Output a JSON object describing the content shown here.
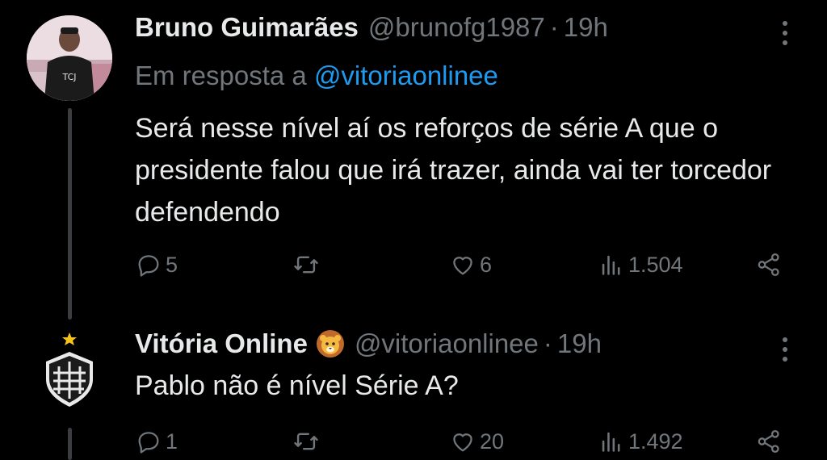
{
  "tweets": [
    {
      "name": "Bruno Guimarães",
      "handle": "@brunofg1987",
      "separator": "·",
      "time": "19h",
      "replying_prefix": "Em resposta a",
      "replying_to": "@vitoriaonlinee",
      "text": "Será nesse nível aí os reforços de série A que o presidente falou que irá trazer, ainda vai ter torcedor defendendo",
      "avatar_shirt_text": "TCJ",
      "replies": "5",
      "retweets": "",
      "likes": "6",
      "views": "1.504"
    },
    {
      "name": "Vitória Online",
      "handle": "@vitoriaonlinee",
      "separator": "·",
      "time": "19h",
      "text": "Pablo não é nível Série A?",
      "replies": "1",
      "retweets": "",
      "likes": "20",
      "views": "1.492"
    }
  ],
  "colors": {
    "background": "#000000",
    "text": "#e7e9ea",
    "muted": "#71767b",
    "link": "#1d9bf0",
    "crest_star": "#f6c21c"
  },
  "icons": [
    "more-icon",
    "reply-icon",
    "retweet-icon",
    "like-icon",
    "views-icon",
    "share-icon",
    "lion-emoji-icon",
    "club-crest-icon"
  ]
}
